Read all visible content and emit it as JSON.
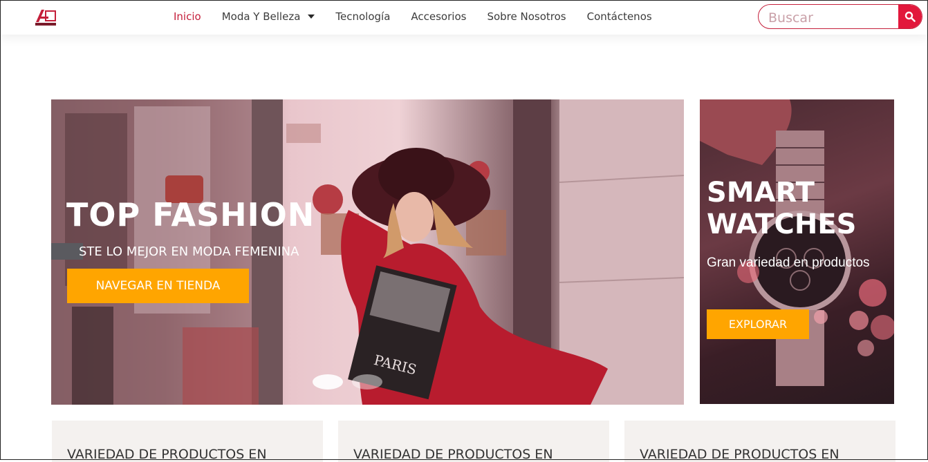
{
  "header": {
    "nav": [
      {
        "label": "Inicio"
      },
      {
        "label": "Moda Y Belleza"
      },
      {
        "label": "Tecnología"
      },
      {
        "label": "Accesorios"
      },
      {
        "label": "Sobre Nosotros"
      },
      {
        "label": "Contáctenos"
      }
    ],
    "search_placeholder": "Buscar"
  },
  "hero": {
    "title": "TOP FASHION",
    "subtitle": "STE LO MEJOR EN MODA FEMENINA",
    "button": "NAVEGAR EN TIENDA",
    "book_text": "PARIS",
    "slide_count": 2,
    "active_slide": 1
  },
  "side_banner": {
    "title_line1": "SMART",
    "title_line2": "WATCHES",
    "subtitle": "Gran variedad en productos",
    "button": "EXPLORAR"
  },
  "cards": [
    {
      "label": "VARIEDAD DE PRODUCTOS EN"
    },
    {
      "label": "VARIEDAD DE PRODUCTOS EN"
    },
    {
      "label": "VARIEDAD DE PRODUCTOS EN"
    }
  ],
  "colors": {
    "accent": "#c41e3a",
    "button_orange": "#ffa500",
    "search_button": "#e2183c"
  },
  "icons": {
    "search": "search-icon",
    "dropdown": "chevron-down-icon",
    "logo": "store-logo"
  }
}
